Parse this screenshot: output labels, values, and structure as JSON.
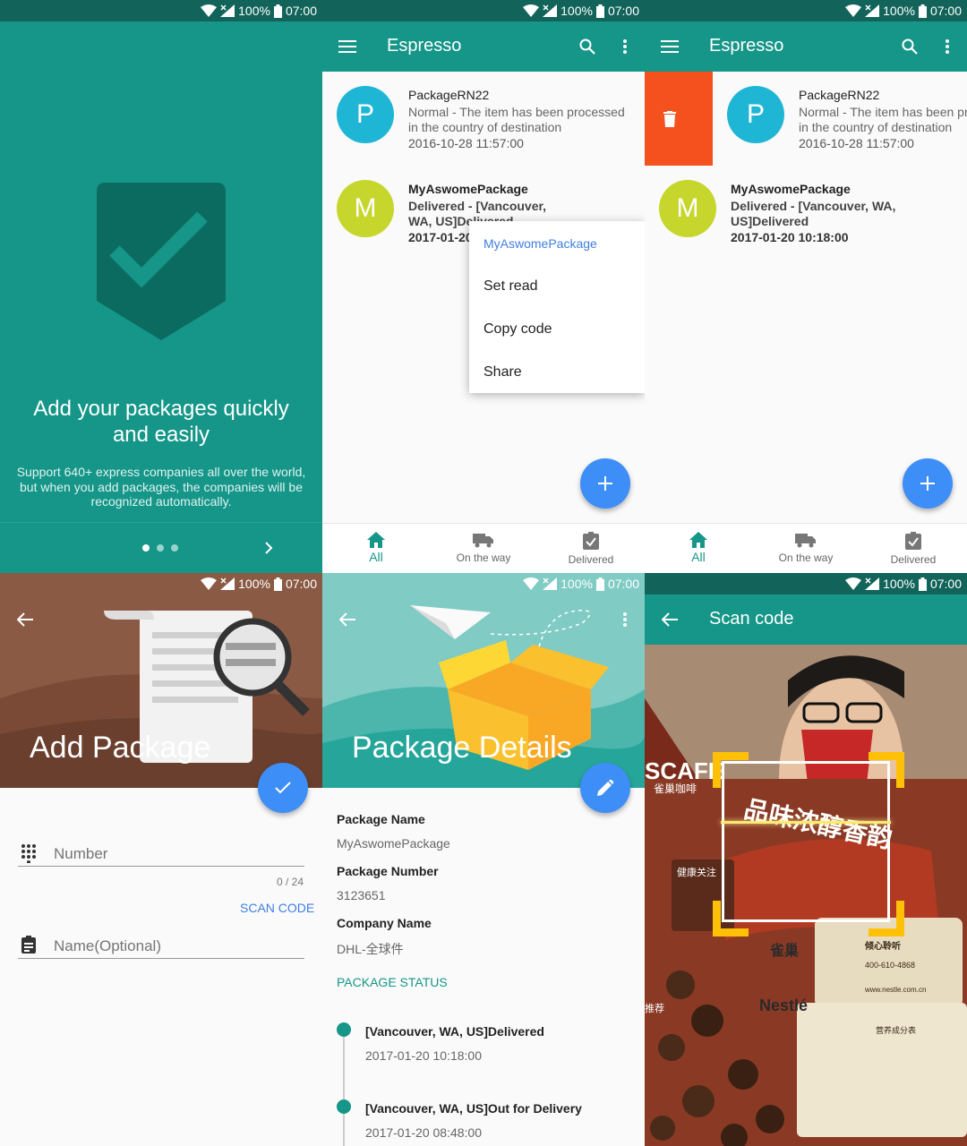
{
  "status_bar": {
    "battery": "100%",
    "time": "07:00"
  },
  "onboarding": {
    "title": "Add your packages quickly and easily",
    "body": "Support 640+ express companies all over the world, but when you add packages, the companies will be recognized automatically.",
    "page_count": 3,
    "current_page": 1
  },
  "list_screen": {
    "app_title": "Espresso",
    "items": [
      {
        "avatar_letter": "P",
        "avatar_color": "#1fb6d6",
        "title": "PackageRN22",
        "body": "Normal - The item has been processed in the country of destination",
        "time": "2016-10-28 11:57:00"
      },
      {
        "avatar_letter": "M",
        "avatar_color": "#c6d62c",
        "title": "MyAswomePackage",
        "body": "Delivered - [Vancouver, WA, US]Delivered",
        "time": "2017-01-20 10:18:00"
      }
    ],
    "context_menu": {
      "header": "MyAswomePackage",
      "items": [
        "Set read",
        "Copy code",
        "Share"
      ]
    },
    "tabs": [
      "All",
      "On the way",
      "Delivered"
    ]
  },
  "add_package": {
    "title": "Add Package",
    "number_placeholder": "Number",
    "counter": "0 / 24",
    "scan_code_label": "SCAN CODE",
    "name_placeholder": "Name(Optional)"
  },
  "package_details": {
    "title": "Package Details",
    "fields": [
      {
        "label": "Package Name",
        "value": "MyAswomePackage"
      },
      {
        "label": "Package Number",
        "value": "3123651"
      },
      {
        "label": "Company Name",
        "value": "DHL-全球件"
      }
    ],
    "status_header": "PACKAGE STATUS",
    "timeline": [
      {
        "event": "[Vancouver, WA, US]Delivered",
        "time": "2017-01-20 10:18:00"
      },
      {
        "event": "[Vancouver, WA, US]Out for Delivery",
        "time": "2017-01-20 08:48:00"
      }
    ]
  },
  "scan_code": {
    "title": "Scan code",
    "poster_text": {
      "cafe": "SCAFE",
      "cafe_sub": "雀巢咖啡",
      "slogan": "品味浓醇香韵",
      "brand": "Nestlé",
      "brand_cn": "雀巢",
      "left_note": "健康关注",
      "hotline_title": "倾心聆听",
      "hotline": "400-610-4868",
      "website": "www.nestle.com.cn",
      "nutrition": "营养成分表",
      "recommend": "推荐"
    }
  },
  "colors": {
    "teal": "#159688",
    "fab_blue": "#3e8ef7",
    "delete_orange": "#f4511e",
    "brown_header": "#8a5a44"
  }
}
